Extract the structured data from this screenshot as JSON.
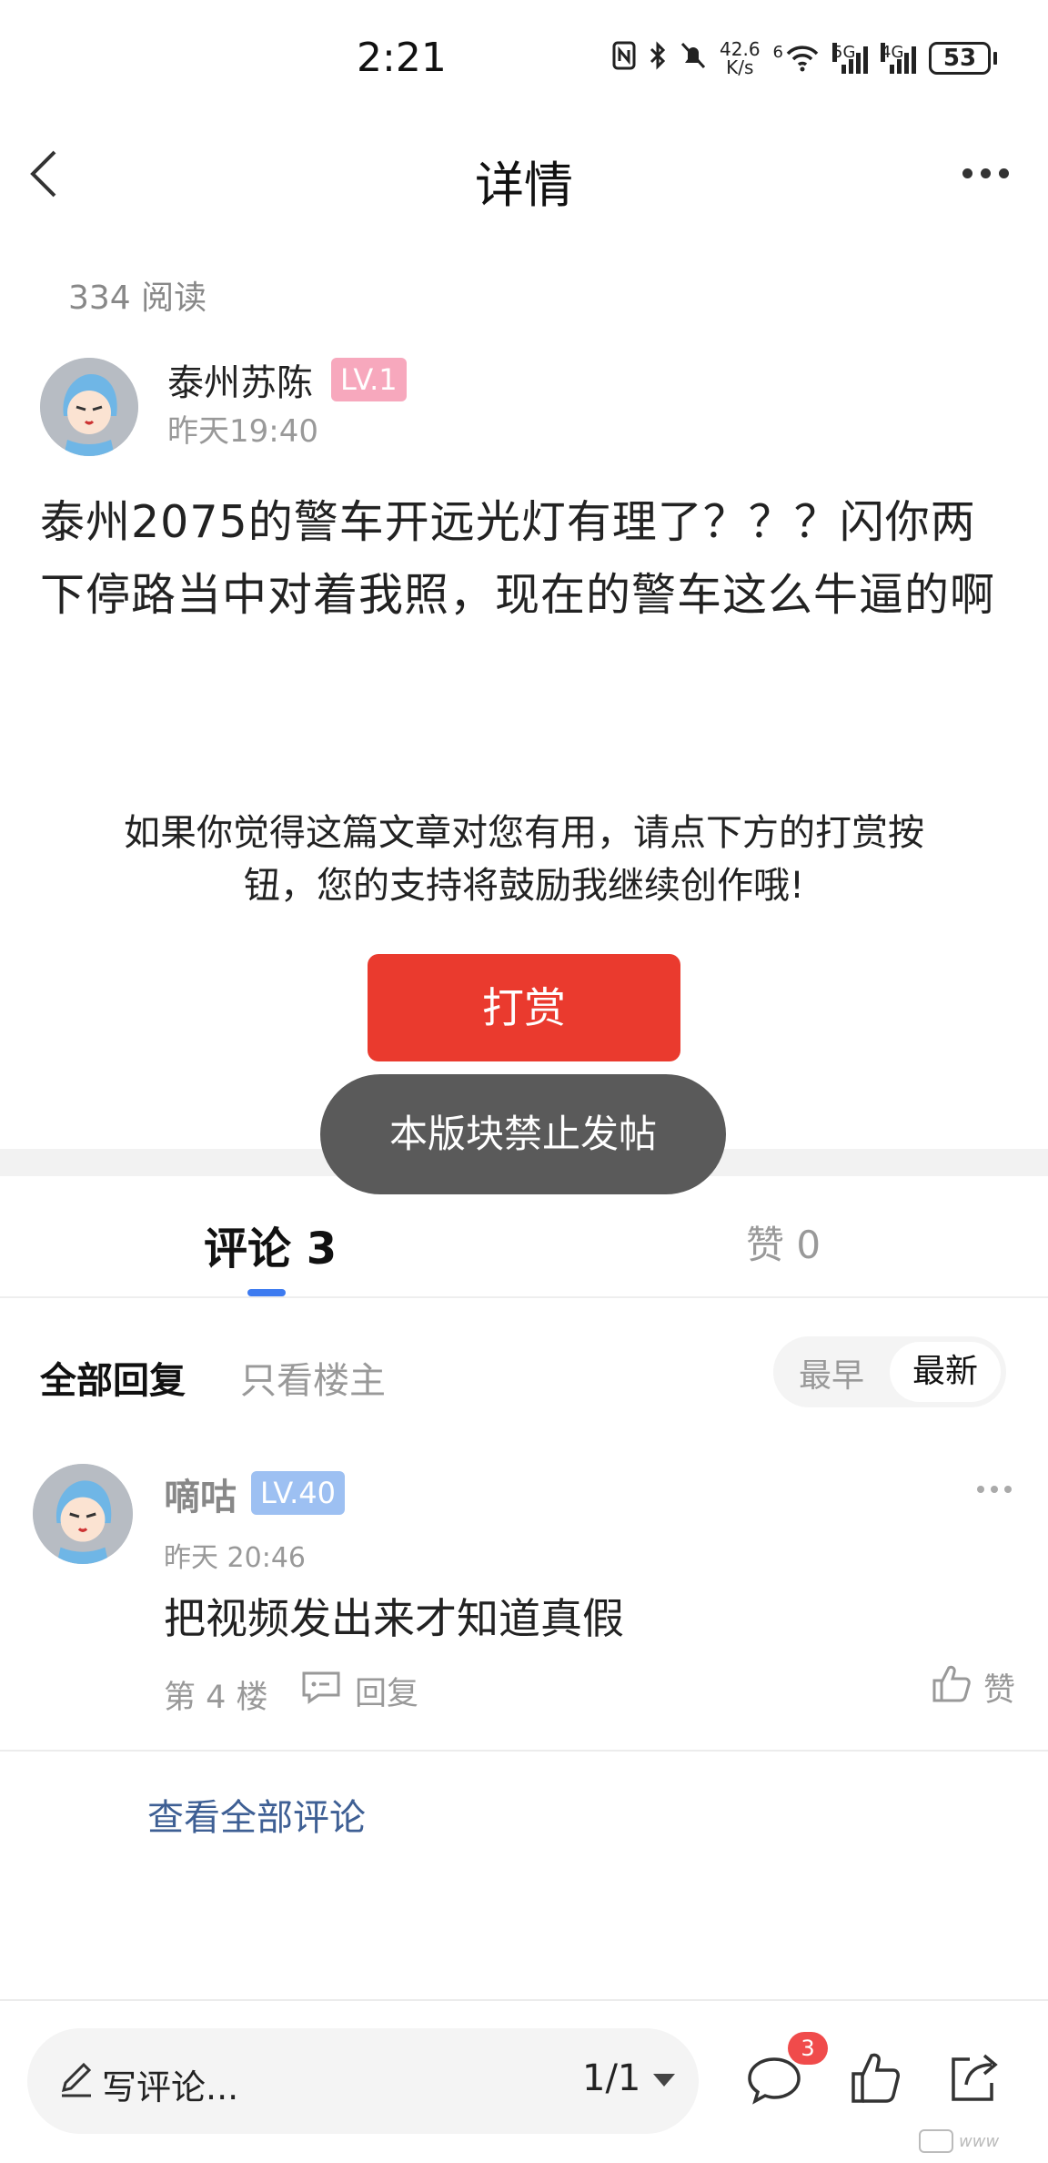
{
  "status_bar": {
    "time": "2:21",
    "net_speed_value": "42.6",
    "net_speed_unit": "K/s",
    "wifi_label": "6",
    "signal1_label": "5G",
    "signal2_label": "4G",
    "battery": "53"
  },
  "nav": {
    "title": "详情"
  },
  "post": {
    "read_count": "334 阅读",
    "author": "泰州苏陈",
    "author_level": "LV.1",
    "time": "昨天19:40",
    "content": "泰州2075的警车开远光灯有理了？？？闪你两下停路当中对着我照，现在的警车这么牛逼的啊"
  },
  "reward": {
    "prompt": "如果你觉得这篇文章对您有用，请点下方的打赏按钮，您的支持将鼓励我继续创作哦!",
    "button_label": "打赏"
  },
  "toast": "本版块禁止发帖",
  "tabs": {
    "comments": "评论 3",
    "likes": "赞 0"
  },
  "filters": {
    "all": "全部回复",
    "op_only": "只看楼主",
    "sort_earliest": "最早",
    "sort_latest": "最新"
  },
  "comments": [
    {
      "user": "嘀咕",
      "level": "LV.40",
      "time": "昨天 20:46",
      "text": "把视频发出来才知道真假",
      "floor": "第 4 楼",
      "reply_label": "回复",
      "like_label": "赞"
    }
  ],
  "view_all_comments": "查看全部评论",
  "bottom_bar": {
    "placeholder": "写评论...",
    "page": "1/1",
    "comment_badge": "3"
  },
  "colors": {
    "reward_button": "#ea3a2e",
    "tab_indicator": "#3d7bf0",
    "author_level_badge": "#f7a8bd",
    "commenter_level_badge": "#9dc0f2",
    "link": "#3e5f94",
    "notification_badge": "#f04b4b"
  },
  "icons": [
    "back-arrow-icon",
    "more-icon",
    "comment-icon",
    "like-icon",
    "share-icon",
    "pencil-icon",
    "reply-icon"
  ]
}
